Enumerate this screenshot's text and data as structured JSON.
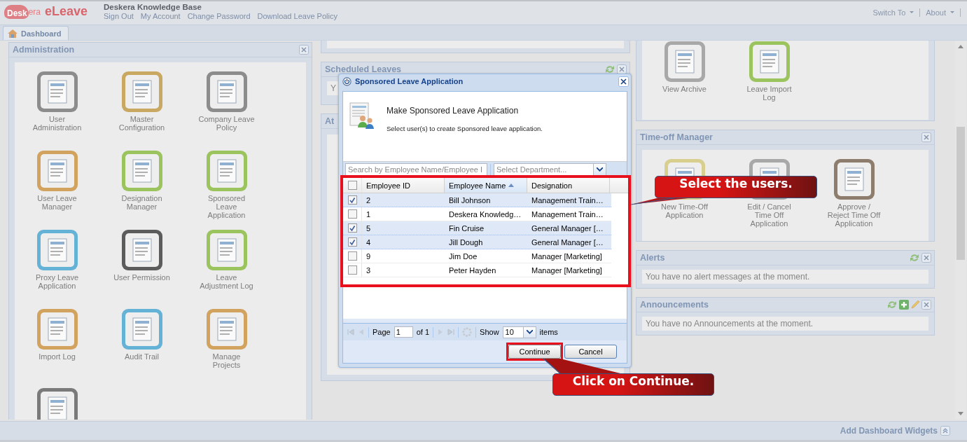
{
  "header": {
    "logo": {
      "mark_1": "Desk",
      "mark_2": "era",
      "product": "eLeave"
    },
    "company": "Deskera Knowledge Base",
    "links": [
      "Sign Out",
      "My Account",
      "Change Password",
      "Download Leave Policy"
    ],
    "menus": [
      "Switch To",
      "About"
    ]
  },
  "tabs": [
    {
      "label": "Dashboard",
      "selected": true
    }
  ],
  "administration": {
    "title": "Administration",
    "tiles": [
      {
        "label": "User Administration",
        "color": "#8c8c8c"
      },
      {
        "label": "Master Configuration",
        "color": "#c9a862"
      },
      {
        "label": "Company Leave Policy",
        "color": "#8c8c8c"
      },
      {
        "label": "User Leave Manager",
        "color": "#d2a35e"
      },
      {
        "label": "Designation Manager",
        "color": "#9cc45e"
      },
      {
        "label": "Sponsored Leave Application",
        "color": "#9cc45e"
      },
      {
        "label": "Proxy Leave Application",
        "color": "#64b2d6"
      },
      {
        "label": "User Permission",
        "color": "#5c5c5c"
      },
      {
        "label": "Leave Adjustment Log",
        "color": "#9cc45e"
      },
      {
        "label": "Import Log",
        "color": "#d2a35e"
      },
      {
        "label": "Audit Trail",
        "color": "#64b2d6"
      },
      {
        "label": "Manage Projects",
        "color": "#d2a35e"
      },
      {
        "color": "#7a7a7a"
      }
    ]
  },
  "scheduled_leaves": {
    "title": "Scheduled Leaves",
    "message": "Y"
  },
  "panel_3": {
    "title": "At"
  },
  "archive_panel": {
    "tiles": [
      {
        "label": "View Archive",
        "color": "#a8a8a8"
      },
      {
        "label": "Leave Import Log",
        "color": "#9cc45e"
      }
    ]
  },
  "time_off_manager": {
    "title": "Time-off Manager",
    "tiles": [
      {
        "label": "New Time-Off Application",
        "color": "#d8cf8e"
      },
      {
        "label": "Edit / Cancel Time Off Application",
        "color": "#a8a8a8"
      },
      {
        "label": "Approve / Reject Time Off Application",
        "color": "#8e7c6c"
      }
    ]
  },
  "alerts": {
    "title": "Alerts",
    "message": "You have no alert messages at the moment."
  },
  "announcements": {
    "title": "Announcements",
    "message": "You have no Announcements at the moment."
  },
  "footer": {
    "label": "Add Dashboard Widgets"
  },
  "dialog": {
    "title": "Sponsored Leave Application",
    "heading": "Make Sponsored Leave Application",
    "subtext": "Select user(s) to create Sponsored leave application.",
    "search": {
      "placeholder": "Search by Employee Name/Employee I"
    },
    "department": {
      "placeholder": "Select Department..."
    },
    "all_selected": false,
    "columns": [
      {
        "label": "Employee ID",
        "sorted": false
      },
      {
        "label": "Employee Name",
        "sorted": true
      },
      {
        "label": "Designation",
        "sorted": false
      }
    ],
    "rows": [
      {
        "id": "2",
        "name": "Bill Johnson",
        "designation": "Management Train…",
        "selected": true
      },
      {
        "id": "1",
        "name": "Deskera Knowledg…",
        "designation": "Management Train…",
        "selected": false
      },
      {
        "id": "5",
        "name": "Fin Cruise",
        "designation": "General Manager […",
        "selected": true
      },
      {
        "id": "4",
        "name": "Jill Dough",
        "designation": "General Manager […",
        "selected": true
      },
      {
        "id": "9",
        "name": "Jim Doe",
        "designation": "Manager [Marketing]",
        "selected": false
      },
      {
        "id": "3",
        "name": "Peter Hayden",
        "designation": "Manager [Marketing]",
        "selected": false
      }
    ],
    "pager": {
      "page_label": "Page",
      "page": "1",
      "of": "of 1",
      "show_label": "Show",
      "size": "10",
      "items_label": "items"
    },
    "buttons": [
      "Continue",
      "Cancel"
    ]
  },
  "callouts": [
    {
      "text": "Select the users."
    },
    {
      "text": "Click on Continue."
    }
  ]
}
